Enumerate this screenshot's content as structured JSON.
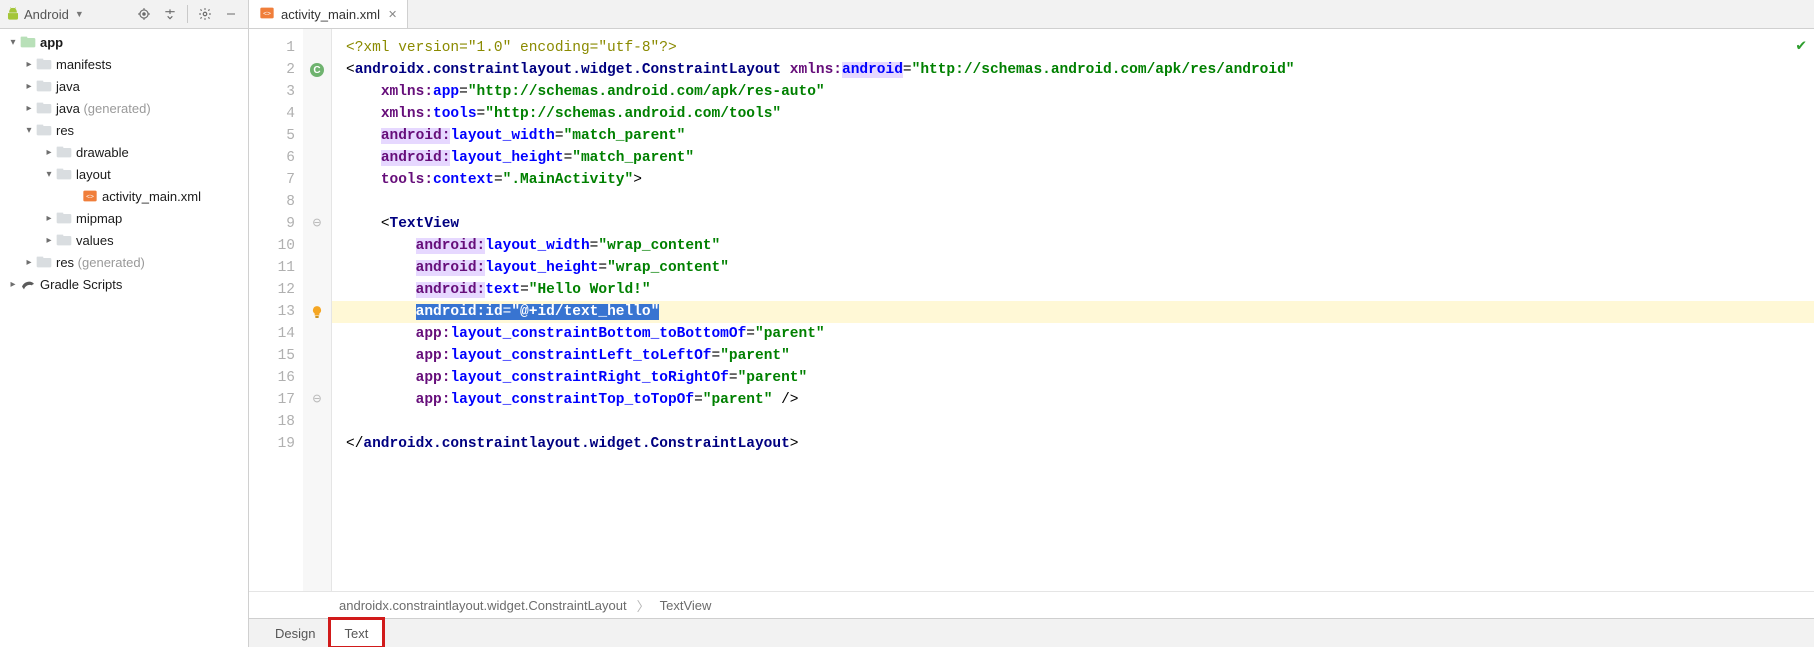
{
  "left_toolbar": {
    "title": "Android"
  },
  "tree": {
    "app": "app",
    "manifests": "manifests",
    "java": "java",
    "java_gen_name": "java",
    "java_gen_suffix": " (generated)",
    "res": "res",
    "drawable": "drawable",
    "layout": "layout",
    "activity_main": "activity_main.xml",
    "mipmap": "mipmap",
    "values": "values",
    "res_gen_name": "res",
    "res_gen_suffix": " (generated)",
    "gradle": "Gradle Scripts"
  },
  "tab": {
    "filename": "activity_main.xml"
  },
  "code": {
    "l1": "<?xml version=\"1.0\" encoding=\"utf-8\"?>",
    "l2_tag": "androidx.constraintlayout.widget.ConstraintLayout",
    "l2_ns": "xmlns:",
    "l2_attr": "android",
    "l2_val": "\"http://schemas.android.com/apk/res/android\"",
    "l3_ns": "xmlns:",
    "l3_attr": "app",
    "l3_val": "\"http://schemas.android.com/apk/res-auto\"",
    "l4_ns": "xmlns:",
    "l4_attr": "tools",
    "l4_val": "\"http://schemas.android.com/tools\"",
    "l5_ns": "android:",
    "l5_attr": "layout_width",
    "l5_val": "\"match_parent\"",
    "l6_ns": "android:",
    "l6_attr": "layout_height",
    "l6_val": "\"match_parent\"",
    "l7_ns": "tools:",
    "l7_attr": "context",
    "l7_val": "\".MainActivity\"",
    "l9_tag": "TextView",
    "l10_ns": "android:",
    "l10_attr": "layout_width",
    "l10_val": "\"wrap_content\"",
    "l11_ns": "android:",
    "l11_attr": "layout_height",
    "l11_val": "\"wrap_content\"",
    "l12_ns": "android:",
    "l12_attr": "text",
    "l12_val": "\"Hello World!\"",
    "l13_ns": "android:",
    "l13_attr": "id",
    "l13_val": "\"@+id/text_hello\"",
    "l14_ns": "app:",
    "l14_attr": "layout_constraintBottom_toBottomOf",
    "l14_val": "\"parent\"",
    "l15_ns": "app:",
    "l15_attr": "layout_constraintLeft_toLeftOf",
    "l15_val": "\"parent\"",
    "l16_ns": "app:",
    "l16_attr": "layout_constraintRight_toRightOf",
    "l16_val": "\"parent\"",
    "l17_ns": "app:",
    "l17_attr": "layout_constraintTop_toTopOf",
    "l17_val": "\"parent\"",
    "l19_tag": "androidx.constraintlayout.widget.ConstraintLayout"
  },
  "line_numbers": [
    "1",
    "2",
    "3",
    "4",
    "5",
    "6",
    "7",
    "8",
    "9",
    "10",
    "11",
    "12",
    "13",
    "14",
    "15",
    "16",
    "17",
    "18",
    "19"
  ],
  "breadcrumb": {
    "a": "androidx.constraintlayout.widget.ConstraintLayout",
    "b": "TextView"
  },
  "bottom": {
    "design": "Design",
    "text": "Text"
  }
}
